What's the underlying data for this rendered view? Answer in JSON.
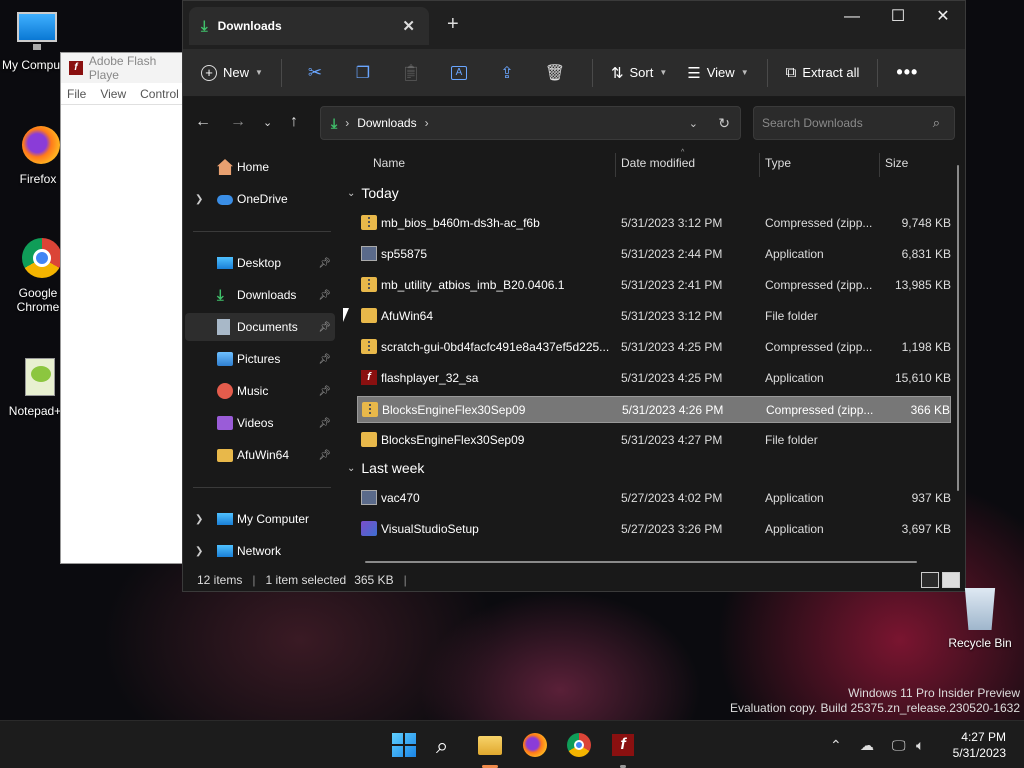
{
  "desktop": {
    "icons": [
      {
        "label": "My Compu"
      },
      {
        "label": "Firefox"
      },
      {
        "label": "Google Chrome"
      },
      {
        "label": "Notepad+"
      }
    ],
    "recycle_bin": "Recycle Bin",
    "watermark_line1": "Windows 11 Pro Insider Preview",
    "watermark_line2": "Evaluation copy. Build 25375.zn_release.230520-1632"
  },
  "flash_window": {
    "title": "Adobe Flash Playe",
    "menu": [
      "File",
      "View",
      "Control"
    ]
  },
  "explorer": {
    "tab_title": "Downloads",
    "toolbar": {
      "new_label": "New",
      "sort_label": "Sort",
      "view_label": "View",
      "extract_label": "Extract all"
    },
    "address": {
      "segment": "Downloads",
      "search_placeholder": "Search Downloads"
    },
    "sidebar": {
      "home": "Home",
      "onedrive": "OneDrive",
      "pinned": [
        "Desktop",
        "Downloads",
        "Documents",
        "Pictures",
        "Music",
        "Videos",
        "AfuWin64"
      ],
      "my_computer": "My Computer",
      "network": "Network"
    },
    "columns": {
      "name": "Name",
      "date": "Date modified",
      "type": "Type",
      "size": "Size"
    },
    "groups": {
      "today": "Today",
      "last_week": "Last week"
    },
    "today_files": [
      {
        "name": "mb_bios_b460m-ds3h-ac_f6b",
        "date": "5/31/2023 3:12 PM",
        "type": "Compressed (zipp...",
        "size": "9,748 KB",
        "icon": "zip-icon"
      },
      {
        "name": "sp55875",
        "date": "5/31/2023 2:44 PM",
        "type": "Application",
        "size": "6,831 KB",
        "icon": "app-icon"
      },
      {
        "name": "mb_utility_atbios_imb_B20.0406.1",
        "date": "5/31/2023 2:41 PM",
        "type": "Compressed (zipp...",
        "size": "13,985 KB",
        "icon": "zip-icon"
      },
      {
        "name": "AfuWin64",
        "date": "5/31/2023 3:12 PM",
        "type": "File folder",
        "size": "",
        "icon": "folder-icon"
      },
      {
        "name": "scratch-gui-0bd4facfc491e8a437ef5d225...",
        "date": "5/31/2023 4:25 PM",
        "type": "Compressed (zipp...",
        "size": "1,198 KB",
        "icon": "zip-icon"
      },
      {
        "name": "flashplayer_32_sa",
        "date": "5/31/2023 4:25 PM",
        "type": "Application",
        "size": "15,610 KB",
        "icon": "flash-icon"
      },
      {
        "name": "BlocksEngineFlex30Sep09",
        "date": "5/31/2023 4:26 PM",
        "type": "Compressed (zipp...",
        "size": "366 KB",
        "icon": "zip-icon"
      },
      {
        "name": "BlocksEngineFlex30Sep09",
        "date": "5/31/2023 4:27 PM",
        "type": "File folder",
        "size": "",
        "icon": "folder-icon"
      }
    ],
    "lastweek_files": [
      {
        "name": "vac470",
        "date": "5/27/2023 4:02 PM",
        "type": "Application",
        "size": "937 KB",
        "icon": "app-icon"
      },
      {
        "name": "VisualStudioSetup",
        "date": "5/27/2023 3:26 PM",
        "type": "Application",
        "size": "3,697 KB",
        "icon": "vs-icon"
      }
    ],
    "status": {
      "count": "12 items",
      "selected": "1 item selected",
      "selected_size": "365 KB"
    }
  },
  "taskbar": {
    "time": "4:27 PM",
    "date": "5/31/2023"
  }
}
